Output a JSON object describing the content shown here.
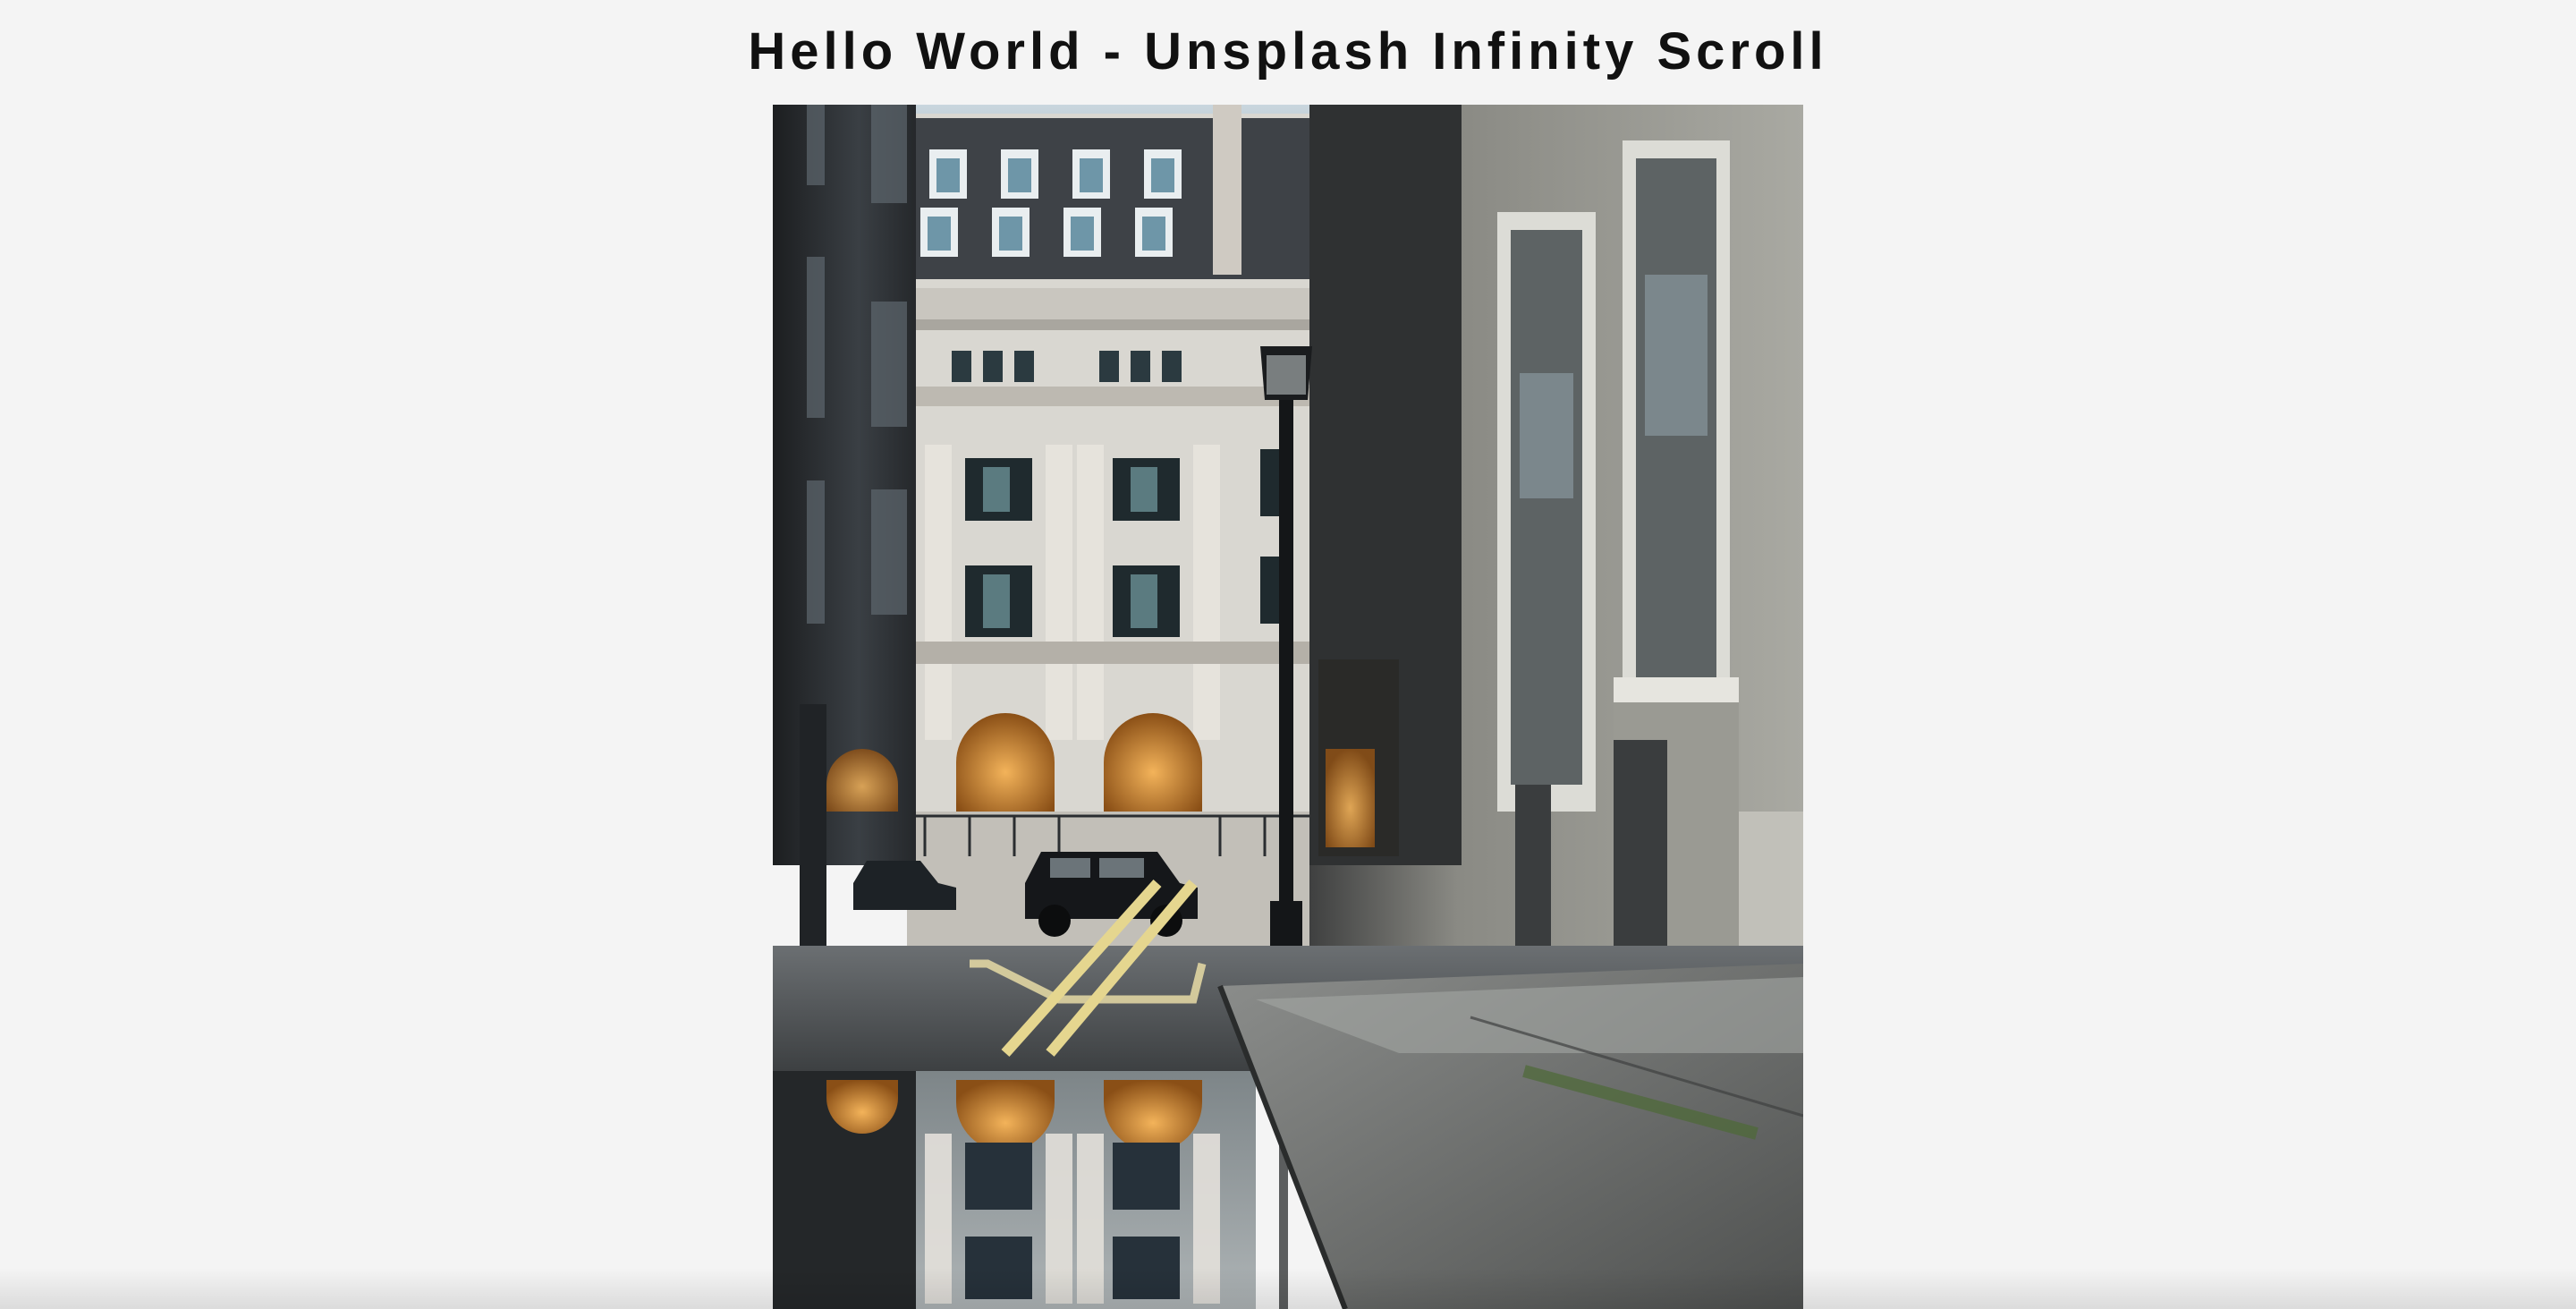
{
  "page": {
    "title": "Hello World - Unsplash Infinity Scroll",
    "background_color": "#f4f4f4"
  },
  "gallery": {
    "items": [
      {
        "kind": "photo",
        "depicts": "street-puddle-reflection-icon"
      }
    ]
  }
}
